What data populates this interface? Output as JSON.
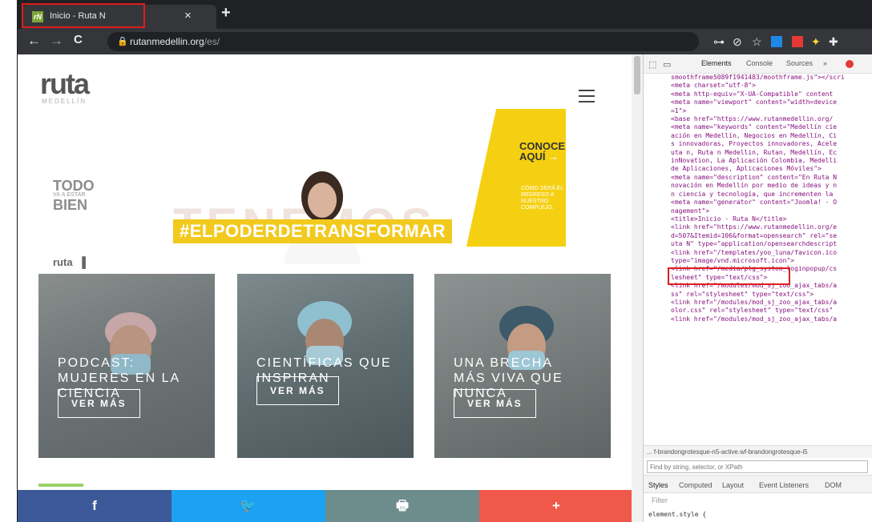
{
  "browser": {
    "tab_title": "Inicio - Ruta N",
    "tab_close": "×",
    "new_tab": "+",
    "url_domain": "rutanmedellin.org",
    "url_path": "/es/",
    "back": "←",
    "forward": "→",
    "reload": "C"
  },
  "site": {
    "logo": "ruta",
    "logo_sub": "MEDELLÍN",
    "todo_1": "TODO",
    "todo_small": "VA A ESTAR",
    "todo_2": "BIEN",
    "small_logo": "ruta",
    "big_word": "TENEMOS",
    "hashtag": "#ELPODERDETRANSFORMAR",
    "conoce_1": "CONOCE",
    "conoce_2": "AQUÍ",
    "conoce_arrow": "→",
    "conoce_sub": "CÓMO SERÁ EL REGRESO A NUESTRO COMPLEJO.",
    "cards": [
      {
        "title": "PODCAST: MUJERES EN LA CIENCIA",
        "button": "VER MÁS"
      },
      {
        "title": "CIENTÍFICAS QUE INSPIRAN",
        "button": "VER MÁS"
      },
      {
        "title": "UNA BRECHA MÁS VIVA QUE NUNCA",
        "button": "VER MÁS"
      }
    ],
    "share": {
      "facebook": "f",
      "twitter": "🐦",
      "print": "🖶",
      "more": "+"
    }
  },
  "devtools": {
    "tabs": [
      "Elements",
      "Console",
      "Sources",
      "»"
    ],
    "lines": [
      {
        "t": "smoothframe5089f1941483/moothframe.js\"></scri"
      },
      {
        "t": "<meta charset=\"utf-8\">"
      },
      {
        "t": "<meta http-equiv=\"X-UA-Compatible\" content"
      },
      {
        "t": "<meta name=\"viewport\" content=\"width=device"
      },
      {
        "t": "=1\">"
      },
      {
        "t": "<base href=\"https://www.rutanmedellin.org/"
      },
      {
        "t": "<meta name=\"keywords\" content=\"Medellín cie"
      },
      {
        "t": "ación en Medellín, Negocios en Medellín, Ci"
      },
      {
        "t": "s innovadoras, Proyectos innovadores, Acele"
      },
      {
        "t": "uta n, Ruta n Medellin, Rutan, Medellín, Ec"
      },
      {
        "t": "inNovation, La Aplicación Colombia, Medelli"
      },
      {
        "t": "de Aplicaciones, Aplicaciones Móviles\">"
      },
      {
        "t": "<meta name=\"description\" content=\"En Ruta N"
      },
      {
        "t": "novación en Medellín por medio de ideas y n"
      },
      {
        "t": "n ciencia y tecnología, que incrementen la"
      },
      {
        "t": "<meta name=\"generator\" content=\"Joomla! - O"
      },
      {
        "t": "nagement\">"
      },
      {
        "t": "<title>Inicio - Ruta N</title>"
      },
      {
        "t": "<link href=\"https://www.rutanmedellin.org/e"
      },
      {
        "t": "d=507&Itemid=106&format=opensearch\" rel=\"se"
      },
      {
        "t": "uta N\" type=\"application/opensearchdescript"
      },
      {
        "t": "<link href=\"/templates/yoo_luna/favicon.ico"
      },
      {
        "t": "type=\"image/vnd.microsoft.icon\">"
      },
      {
        "t": "<link href=\"/media/plg_system_loginpopup/cs"
      },
      {
        "t": "lesheet\" type=\"text/css\">"
      },
      {
        "t": "<link href=\"/modules/mod_sj_zoo_ajax_tabs/a"
      },
      {
        "t": "ss\" rel=\"stylesheet\" type=\"text/css\">"
      },
      {
        "t": "<link href=\"/modules/mod_sj_zoo_ajax_tabs/a"
      },
      {
        "t": "olor.css\" rel=\"stylesheet\" type=\"text/css\""
      },
      {
        "t": "<link href=\"/modules/mod_sj_zoo_ajax_tabs/a"
      }
    ],
    "breadcrumb": "... f-brandongrotesque-n5-active.wf-brandongrotesque-i5",
    "find_placeholder": "Find by string, selector, or XPath",
    "styles_tabs": [
      "Styles",
      "Computed",
      "Layout",
      "Event Listeners",
      "DOM"
    ],
    "filter": "Filter",
    "element_style": "element.style {"
  },
  "colors": {
    "facebook": "#3b5998",
    "twitter": "#1da1f2",
    "print": "#6d8c8c",
    "more": "#f0594a",
    "highlight": "#e01c1c",
    "banner_yellow": "#f5d012"
  }
}
